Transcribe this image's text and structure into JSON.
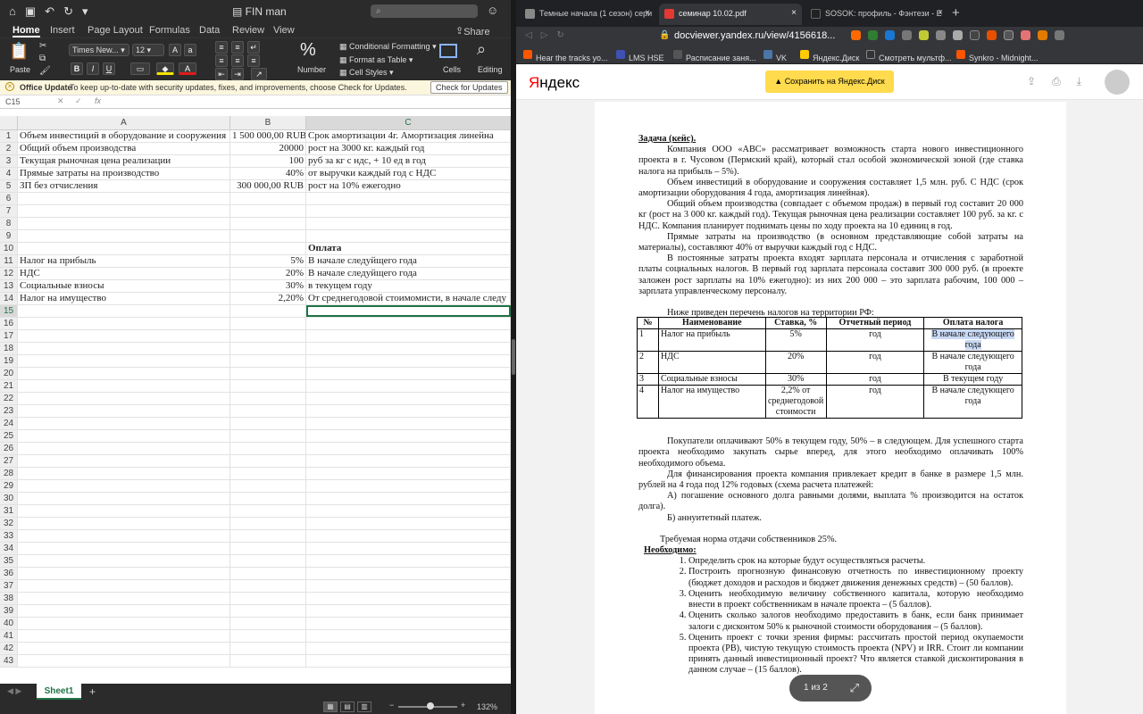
{
  "excel": {
    "title": "FIN man",
    "search": "",
    "tabs": [
      "Home",
      "Insert",
      "Page Layout",
      "Formulas",
      "Data",
      "Review",
      "View"
    ],
    "share": "Share",
    "ribbon": {
      "paste": "Paste",
      "font": "Times New...",
      "size": "12",
      "number": "Number",
      "cond": "Conditional Formatting",
      "format_table": "Format as Table",
      "cell_styles": "Cell Styles",
      "cells": "Cells",
      "editing": "Editing"
    },
    "update": {
      "title": "Office Update",
      "text": "To keep up-to-date with security updates, fixes, and improvements, choose Check for Updates.",
      "button": "Check for Updates"
    },
    "namebox": "C15",
    "fx": "fx",
    "columns": [
      "A",
      "B",
      "C"
    ],
    "rows": [
      {
        "n": "1",
        "a": "Объем инвестиций в оборудование и сооружения",
        "b": "1 500 000,00 RUB",
        "c": "Срок амортизации 4г. Амортизация линейна"
      },
      {
        "n": "2",
        "a": "Общий объем производства",
        "b": "20000",
        "c": "рост на 3000 кг. каждый год"
      },
      {
        "n": "3",
        "a": "Текущая рыночная цена реализации",
        "b": "100",
        "c": "руб за кг с ндс, + 10 ед в год"
      },
      {
        "n": "4",
        "a": "Прямые затраты на производство",
        "b": "40%",
        "c": "от выручки каждый год с НДС"
      },
      {
        "n": "5",
        "a": "ЗП без отчисления",
        "b": "300 000,00 RUB",
        "c": "рост на 10% ежегодно"
      },
      {
        "n": "6",
        "a": "",
        "b": "",
        "c": ""
      },
      {
        "n": "7",
        "a": "",
        "b": "",
        "c": ""
      },
      {
        "n": "8",
        "a": "",
        "b": "",
        "c": ""
      },
      {
        "n": "9",
        "a": "",
        "b": "",
        "c": ""
      },
      {
        "n": "10",
        "a": "",
        "b": "",
        "c": "Оплата"
      },
      {
        "n": "11",
        "a": "Налог на прибыль",
        "b": "5%",
        "c": "В начале следуйщего года"
      },
      {
        "n": "12",
        "a": "НДС",
        "b": "20%",
        "c": "В начале следуйщего года"
      },
      {
        "n": "13",
        "a": "Социальные взносы",
        "b": "30%",
        "c": "в текущем году"
      },
      {
        "n": "14",
        "a": "Налог на имущество",
        "b": "2,20%",
        "c": "От среднегодовой стоимомисти, в начале следу"
      },
      {
        "n": "15",
        "a": "",
        "b": "",
        "c": ""
      },
      {
        "n": "16",
        "a": "",
        "b": "",
        "c": ""
      },
      {
        "n": "17",
        "a": "",
        "b": "",
        "c": ""
      },
      {
        "n": "18",
        "a": "",
        "b": "",
        "c": ""
      },
      {
        "n": "19",
        "a": "",
        "b": "",
        "c": ""
      },
      {
        "n": "20",
        "a": "",
        "b": "",
        "c": ""
      },
      {
        "n": "21",
        "a": "",
        "b": "",
        "c": ""
      },
      {
        "n": "22",
        "a": "",
        "b": "",
        "c": ""
      },
      {
        "n": "23",
        "a": "",
        "b": "",
        "c": ""
      },
      {
        "n": "24",
        "a": "",
        "b": "",
        "c": ""
      },
      {
        "n": "25",
        "a": "",
        "b": "",
        "c": ""
      },
      {
        "n": "26",
        "a": "",
        "b": "",
        "c": ""
      },
      {
        "n": "27",
        "a": "",
        "b": "",
        "c": ""
      },
      {
        "n": "28",
        "a": "",
        "b": "",
        "c": ""
      },
      {
        "n": "29",
        "a": "",
        "b": "",
        "c": ""
      },
      {
        "n": "30",
        "a": "",
        "b": "",
        "c": ""
      },
      {
        "n": "31",
        "a": "",
        "b": "",
        "c": ""
      },
      {
        "n": "32",
        "a": "",
        "b": "",
        "c": ""
      },
      {
        "n": "33",
        "a": "",
        "b": "",
        "c": ""
      },
      {
        "n": "34",
        "a": "",
        "b": "",
        "c": ""
      },
      {
        "n": "35",
        "a": "",
        "b": "",
        "c": ""
      },
      {
        "n": "36",
        "a": "",
        "b": "",
        "c": ""
      },
      {
        "n": "37",
        "a": "",
        "b": "",
        "c": ""
      },
      {
        "n": "38",
        "a": "",
        "b": "",
        "c": ""
      },
      {
        "n": "39",
        "a": "",
        "b": "",
        "c": ""
      },
      {
        "n": "40",
        "a": "",
        "b": "",
        "c": ""
      },
      {
        "n": "41",
        "a": "",
        "b": "",
        "c": ""
      },
      {
        "n": "42",
        "a": "",
        "b": "",
        "c": ""
      },
      {
        "n": "43",
        "a": "",
        "b": "",
        "c": ""
      }
    ],
    "sheet": "Sheet1",
    "zoom": "132%"
  },
  "browser": {
    "tabs": [
      {
        "label": "Темные начала (1 сезон) сери",
        "color": "#888"
      },
      {
        "label": "семинар 10.02.pdf",
        "color": "#e53935"
      },
      {
        "label": "SOSOK: профиль - Фэнтези - E",
        "color": "#222"
      }
    ],
    "url": "docviewer.yandex.ru/view/4156618...",
    "bookmarks": [
      "Hear the tracks yo...",
      "LMS HSE",
      "Расписание заня...",
      "VK",
      "Яндекс.Диск",
      "Смотреть мультф...",
      "Synkro - Midnight..."
    ],
    "logo_first": "Я",
    "logo_rest": "ндекс",
    "save": "Сохранить на Яндекс.Диск",
    "pager": "1 из 2"
  },
  "doc": {
    "task": "Задача (кейс).",
    "p1": "Компания ООО «АВС» рассматривает возможность старта нового инвестиционного проекта в г. Чусовом (Пермский край), который стал особой экономической зоной (где ставка налога на прибыль – 5%).",
    "p2": "Объем инвестиций в оборудование и сооружения составляет 1,5 млн. руб. С НДС (срок амортизации оборудования 4 года, амортизация линейная).",
    "p3": "Общий объем производства (совпадает с объемом продаж) в первый год составит 20 000 кг (рост на 3 000 кг. каждый год). Текущая рыночная цена реализации составляет 100 руб. за кг. с НДС. Компания планирует поднимать цены по ходу проекта на 10 единиц в год.",
    "p4": "Прямые затраты на производство (в основном представляющие собой затраты на материалы), составляют 40% от выручки каждый год с НДС.",
    "p5": "В постоянные затраты проекта входят зарплата персонала и отчисления с заработной платы социальных налогов. В первый год зарплата персонала составит 300 000 руб. (в проекте заложен рост зарплаты на 10% ежегодно): из них 200 000 – это зарплата рабочим, 100 000 – зарплата управленческому персоналу.",
    "p6": "Ниже приведен перечень налогов на территории РФ:",
    "thead": [
      "№",
      "Наименование",
      "Ставка, %",
      "Отчетный период",
      "Оплата налога"
    ],
    "trows": [
      [
        "1",
        "Налог на прибыль",
        "5%",
        "год",
        "В начале следующего года"
      ],
      [
        "2",
        "НДС",
        "20%",
        "год",
        "В начале следующего года"
      ],
      [
        "3",
        "Социальные взносы",
        "30%",
        "год",
        "В текущем году"
      ],
      [
        "4",
        "Налог на имущество",
        "2,2% от среднегодовой стоимости",
        "год",
        "В начале следующего года"
      ]
    ],
    "p7": "Покупатели оплачивают 50% в текущем году, 50% – в следующем. Для успешного старта проекта необходимо закупать сырье вперед, для этого необходимо оплачивать 100% необходимого объема.",
    "p8": "Для финансирования проекта компания привлекает кредит в банке в размере 1,5 млн. рублей на 4 года под 12% годовых (схема расчета платежей:",
    "p9": "А) погашение основного долга равными долями, выплата % производится на остаток долга).",
    "p10": "Б) аннуитетный платеж.",
    "p11": "Требуемая норма отдачи собственников 25%.",
    "need": "Необходимо:",
    "items": [
      "Определить срок на которые будут осуществляться расчеты.",
      "Построить прогнозную финансовую отчетность по инвестиционному проекту (бюджет доходов и расходов и бюджет движения денежных средств) – (50 баллов).",
      "Оценить необходимую величину собственного капитала, которую необходимо внести в проект собственникам в начале проекта – (5 баллов).",
      "Оценить сколько залогов необходимо предоставить в банк, если банк принимает залоги с дисконтом 50% к рыночной стоимости оборудования – (5 баллов).",
      "Оценить проект с точки зрения фирмы: рассчитать простой период окупаемости проекта (PB), чистую текущую стоимость проекта (NPV) и IRR. Стоит ли компании принять данный инвестиционный проект? Что является ставкой дисконтирования в данном случае – (15 баллов)."
    ]
  }
}
